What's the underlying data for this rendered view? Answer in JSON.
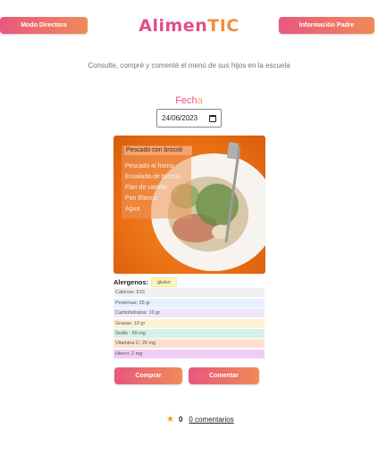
{
  "header": {
    "left_button": "Modo Directora",
    "right_button": "Información Padre",
    "logo_part1": "Alimen",
    "logo_part2": "TIC"
  },
  "subtitle": "Consulte, compré y comenté el menú de sus hijos en la escuela",
  "date": {
    "label_main": "Fech",
    "label_tail": "a",
    "value": "24/06/2023"
  },
  "menu": {
    "title": "Pescado con brocoli",
    "items": [
      "Pescado al horno",
      "Ensalada de brocoli",
      "Flan de vainilla",
      "Pan Blanco",
      "Agua"
    ]
  },
  "allergens": {
    "label": "Alergenos:",
    "items": [
      "gluten"
    ]
  },
  "nutrition": [
    {
      "text": "Calorías: 610",
      "color": "#f0f0f0"
    },
    {
      "text": "Proteínas: 25 gr",
      "color": "#e6efff"
    },
    {
      "text": "Carbohidratos: 10 gr",
      "color": "#efe6fb"
    },
    {
      "text": "Grasas: 10 gr",
      "color": "#fdf1d3"
    },
    {
      "text": "Sodio : 50 mg",
      "color": "#d4f1e8"
    },
    {
      "text": "Vitamina C: 20 mg",
      "color": "#fde1cc"
    },
    {
      "text": "Hierro: 2 mg",
      "color": "#f0cdf5"
    }
  ],
  "actions": {
    "buy": "Comprar",
    "comment": "Comentar"
  },
  "rating": {
    "count": "0",
    "comments_link": "0 comentarios"
  },
  "colors": {
    "brand_gradient_start": "#e8577f",
    "brand_gradient_end": "#f08a58",
    "star": "#e6a21f"
  }
}
